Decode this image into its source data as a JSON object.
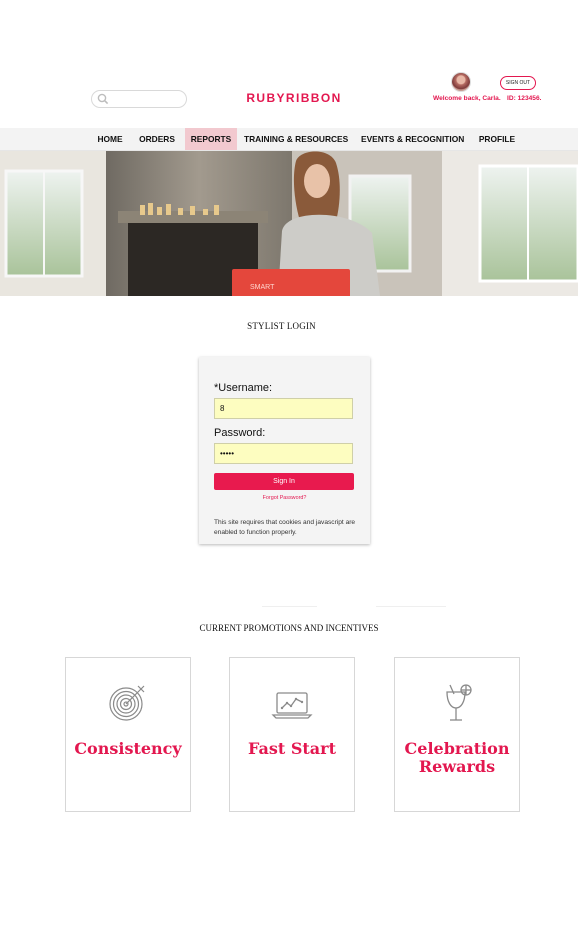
{
  "header": {
    "logo": "RUBYRIBBON",
    "signout_label": "SIGN OUT",
    "welcome": "Welcome back, Carla.",
    "id_label": "ID: 123456."
  },
  "nav": {
    "items": [
      {
        "label": "HOME"
      },
      {
        "label": "ORDERS"
      },
      {
        "label": "REPORTS",
        "active": true
      },
      {
        "label": "TRAINING & RESOURCES"
      },
      {
        "label": "EVENTS & RECOGNITION"
      },
      {
        "label": "PROFILE"
      }
    ]
  },
  "login": {
    "title": "STYLIST LOGIN",
    "username_label": "*Username:",
    "username_value": "8",
    "password_label": "Password:",
    "password_value": "•••••",
    "signin_label": "Sign In",
    "forgot_label": "Forgot Password?",
    "notice": "This site requires that cookies and javascript are enabled to function properly."
  },
  "promos": {
    "title": "CURRENT PROMOTIONS AND INCENTIVES",
    "cards": [
      {
        "title": "Consistency",
        "icon": "target-icon"
      },
      {
        "title": "Fast Start",
        "icon": "laptop-chart-icon"
      },
      {
        "title_line1": "Celebration",
        "title_line2": "Rewards",
        "icon": "cocktail-glass-icon"
      }
    ]
  },
  "colors": {
    "brand": "#e3174f",
    "active_nav": "#f2c9cf",
    "nav_bg": "#f3f3f3",
    "input_bg": "#fdfdc0",
    "button": "#e81a4e"
  }
}
